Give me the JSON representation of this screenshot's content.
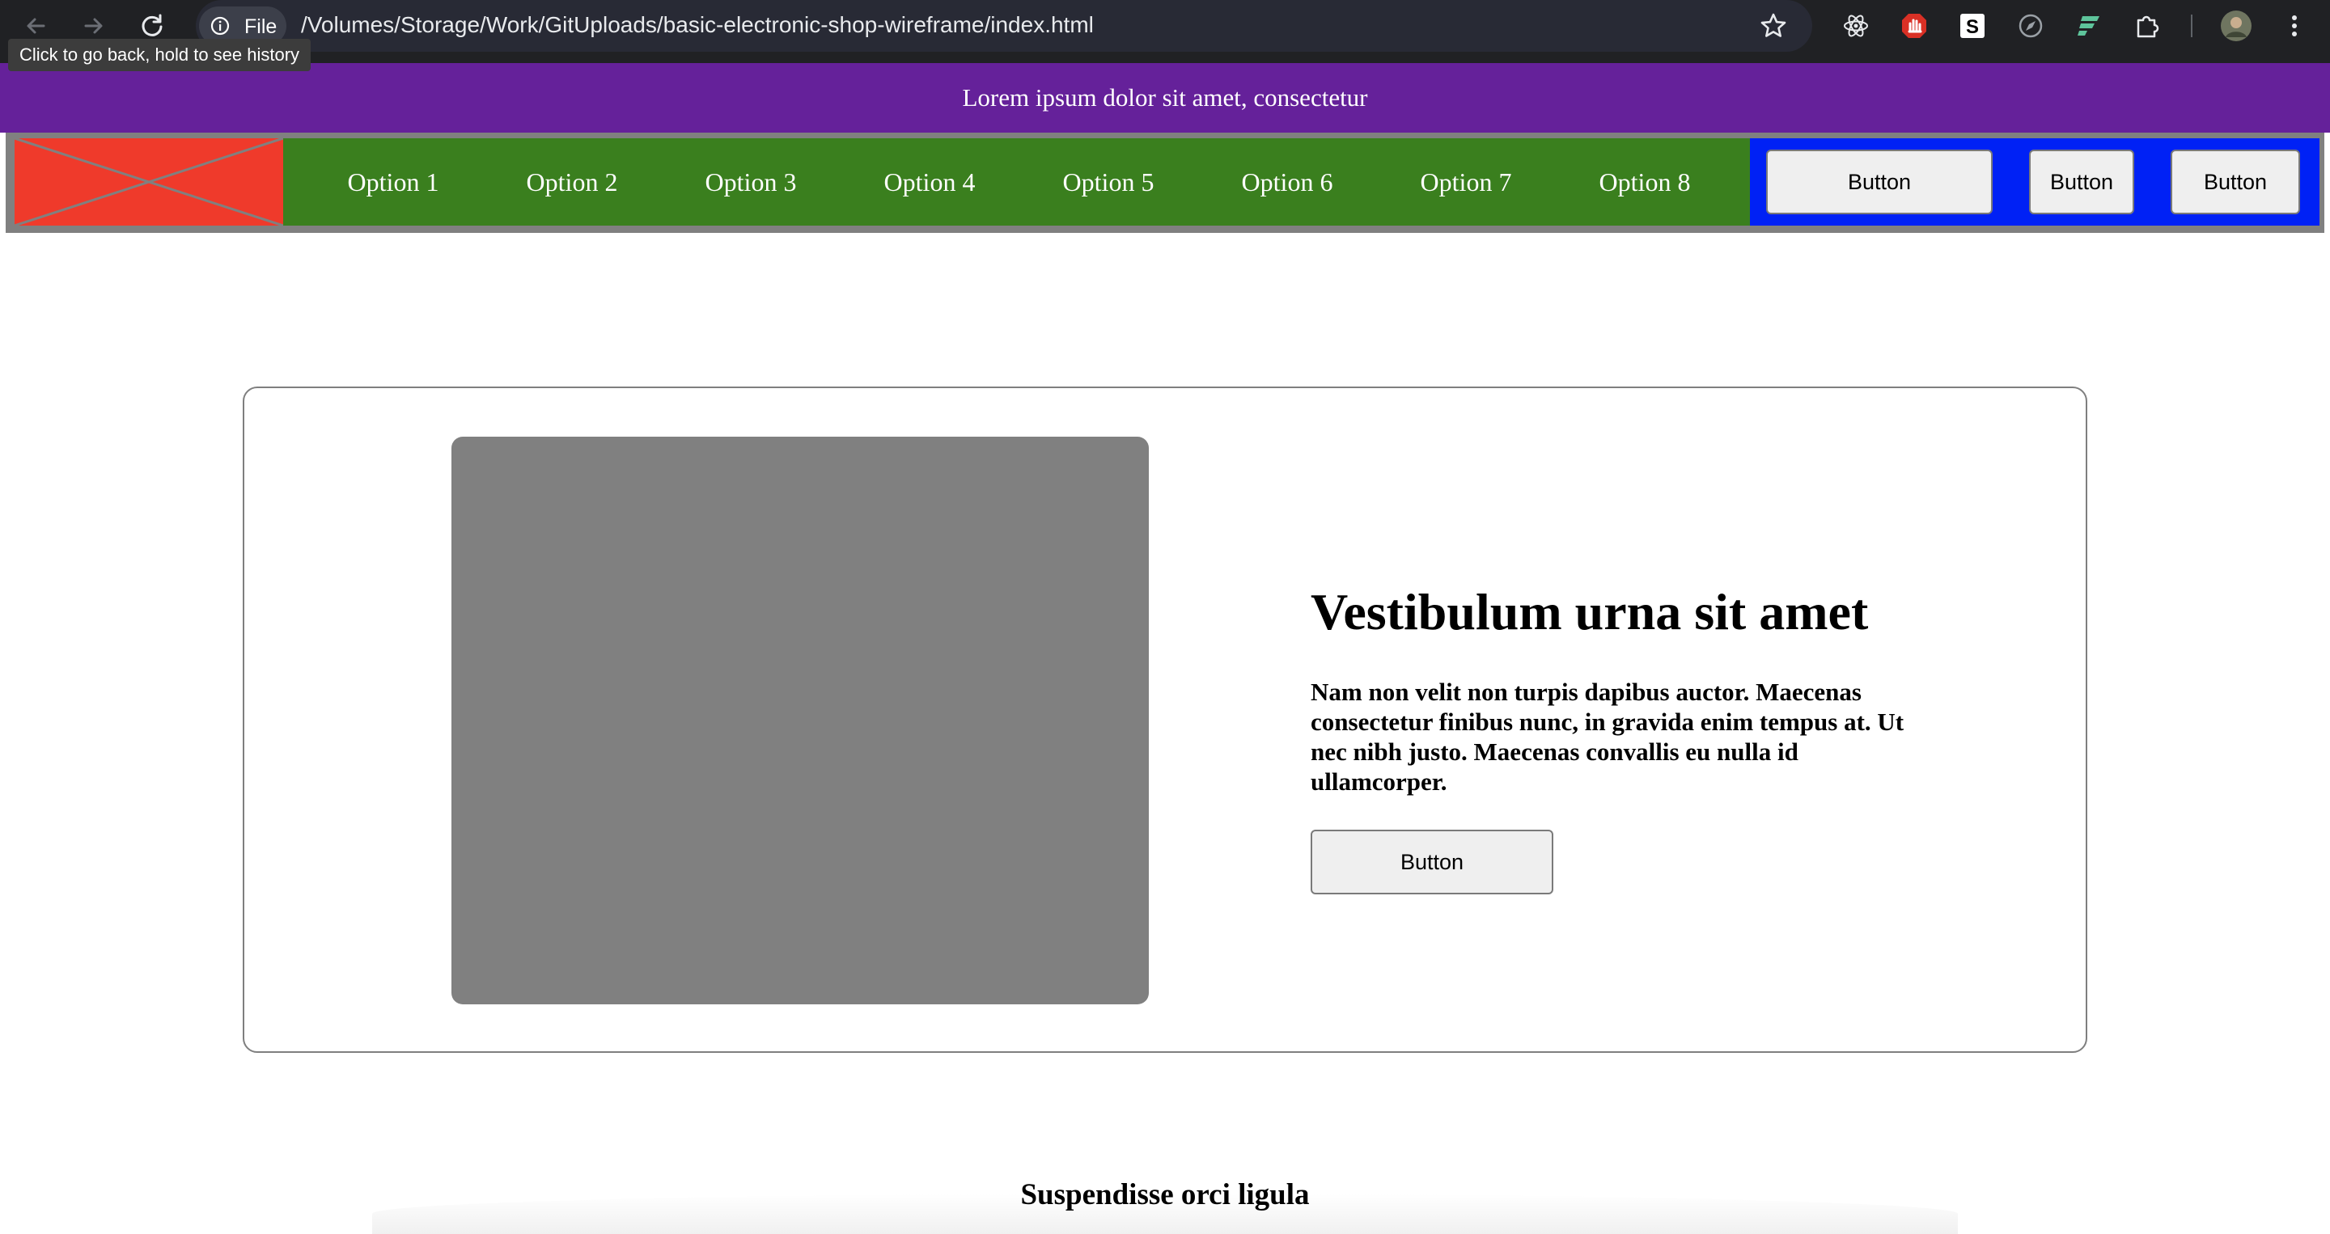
{
  "browser": {
    "site_chip_label": "File",
    "url": "/Volumes/Storage/Work/GitUploads/basic-electronic-shop-wireframe/index.html",
    "back_tooltip": "Click to go back, hold to see history",
    "icons": [
      "back-arrow-icon",
      "forward-arrow-icon",
      "reload-icon",
      "info-icon",
      "star-icon",
      "react-devtools-icon",
      "adblock-icon",
      "s-extension-icon",
      "compass-icon",
      "f-extension-icon",
      "puzzle-icon",
      "profile-avatar",
      "kebab-menu-icon"
    ]
  },
  "announcement": "Lorem ipsum dolor sit amet, consectetur",
  "nav": {
    "menu": [
      "Option 1",
      "Option 2",
      "Option 3",
      "Option 4",
      "Option 5",
      "Option 6",
      "Option 7",
      "Option 8"
    ],
    "buttons": [
      "Button",
      "Button",
      "Button"
    ]
  },
  "hero": {
    "title": "Vestibulum urna sit amet",
    "text": "Nam non velit non turpis dapibus auctor. Maecenas consectetur finibus nunc, in gravida enim tempus at. Ut nec nibh justo. Maecenas convallis eu nulla id ullamcorper.",
    "button": "Button"
  },
  "section_title": "Suspendisse orci ligula",
  "colors": {
    "announcement_bg": "#65219a",
    "nav_bg": "#808080",
    "logo_placeholder": "#ef3a2b",
    "menu_bg": "#3a7f1e",
    "button_area_bg": "#0021f5",
    "image_placeholder": "#808080"
  }
}
